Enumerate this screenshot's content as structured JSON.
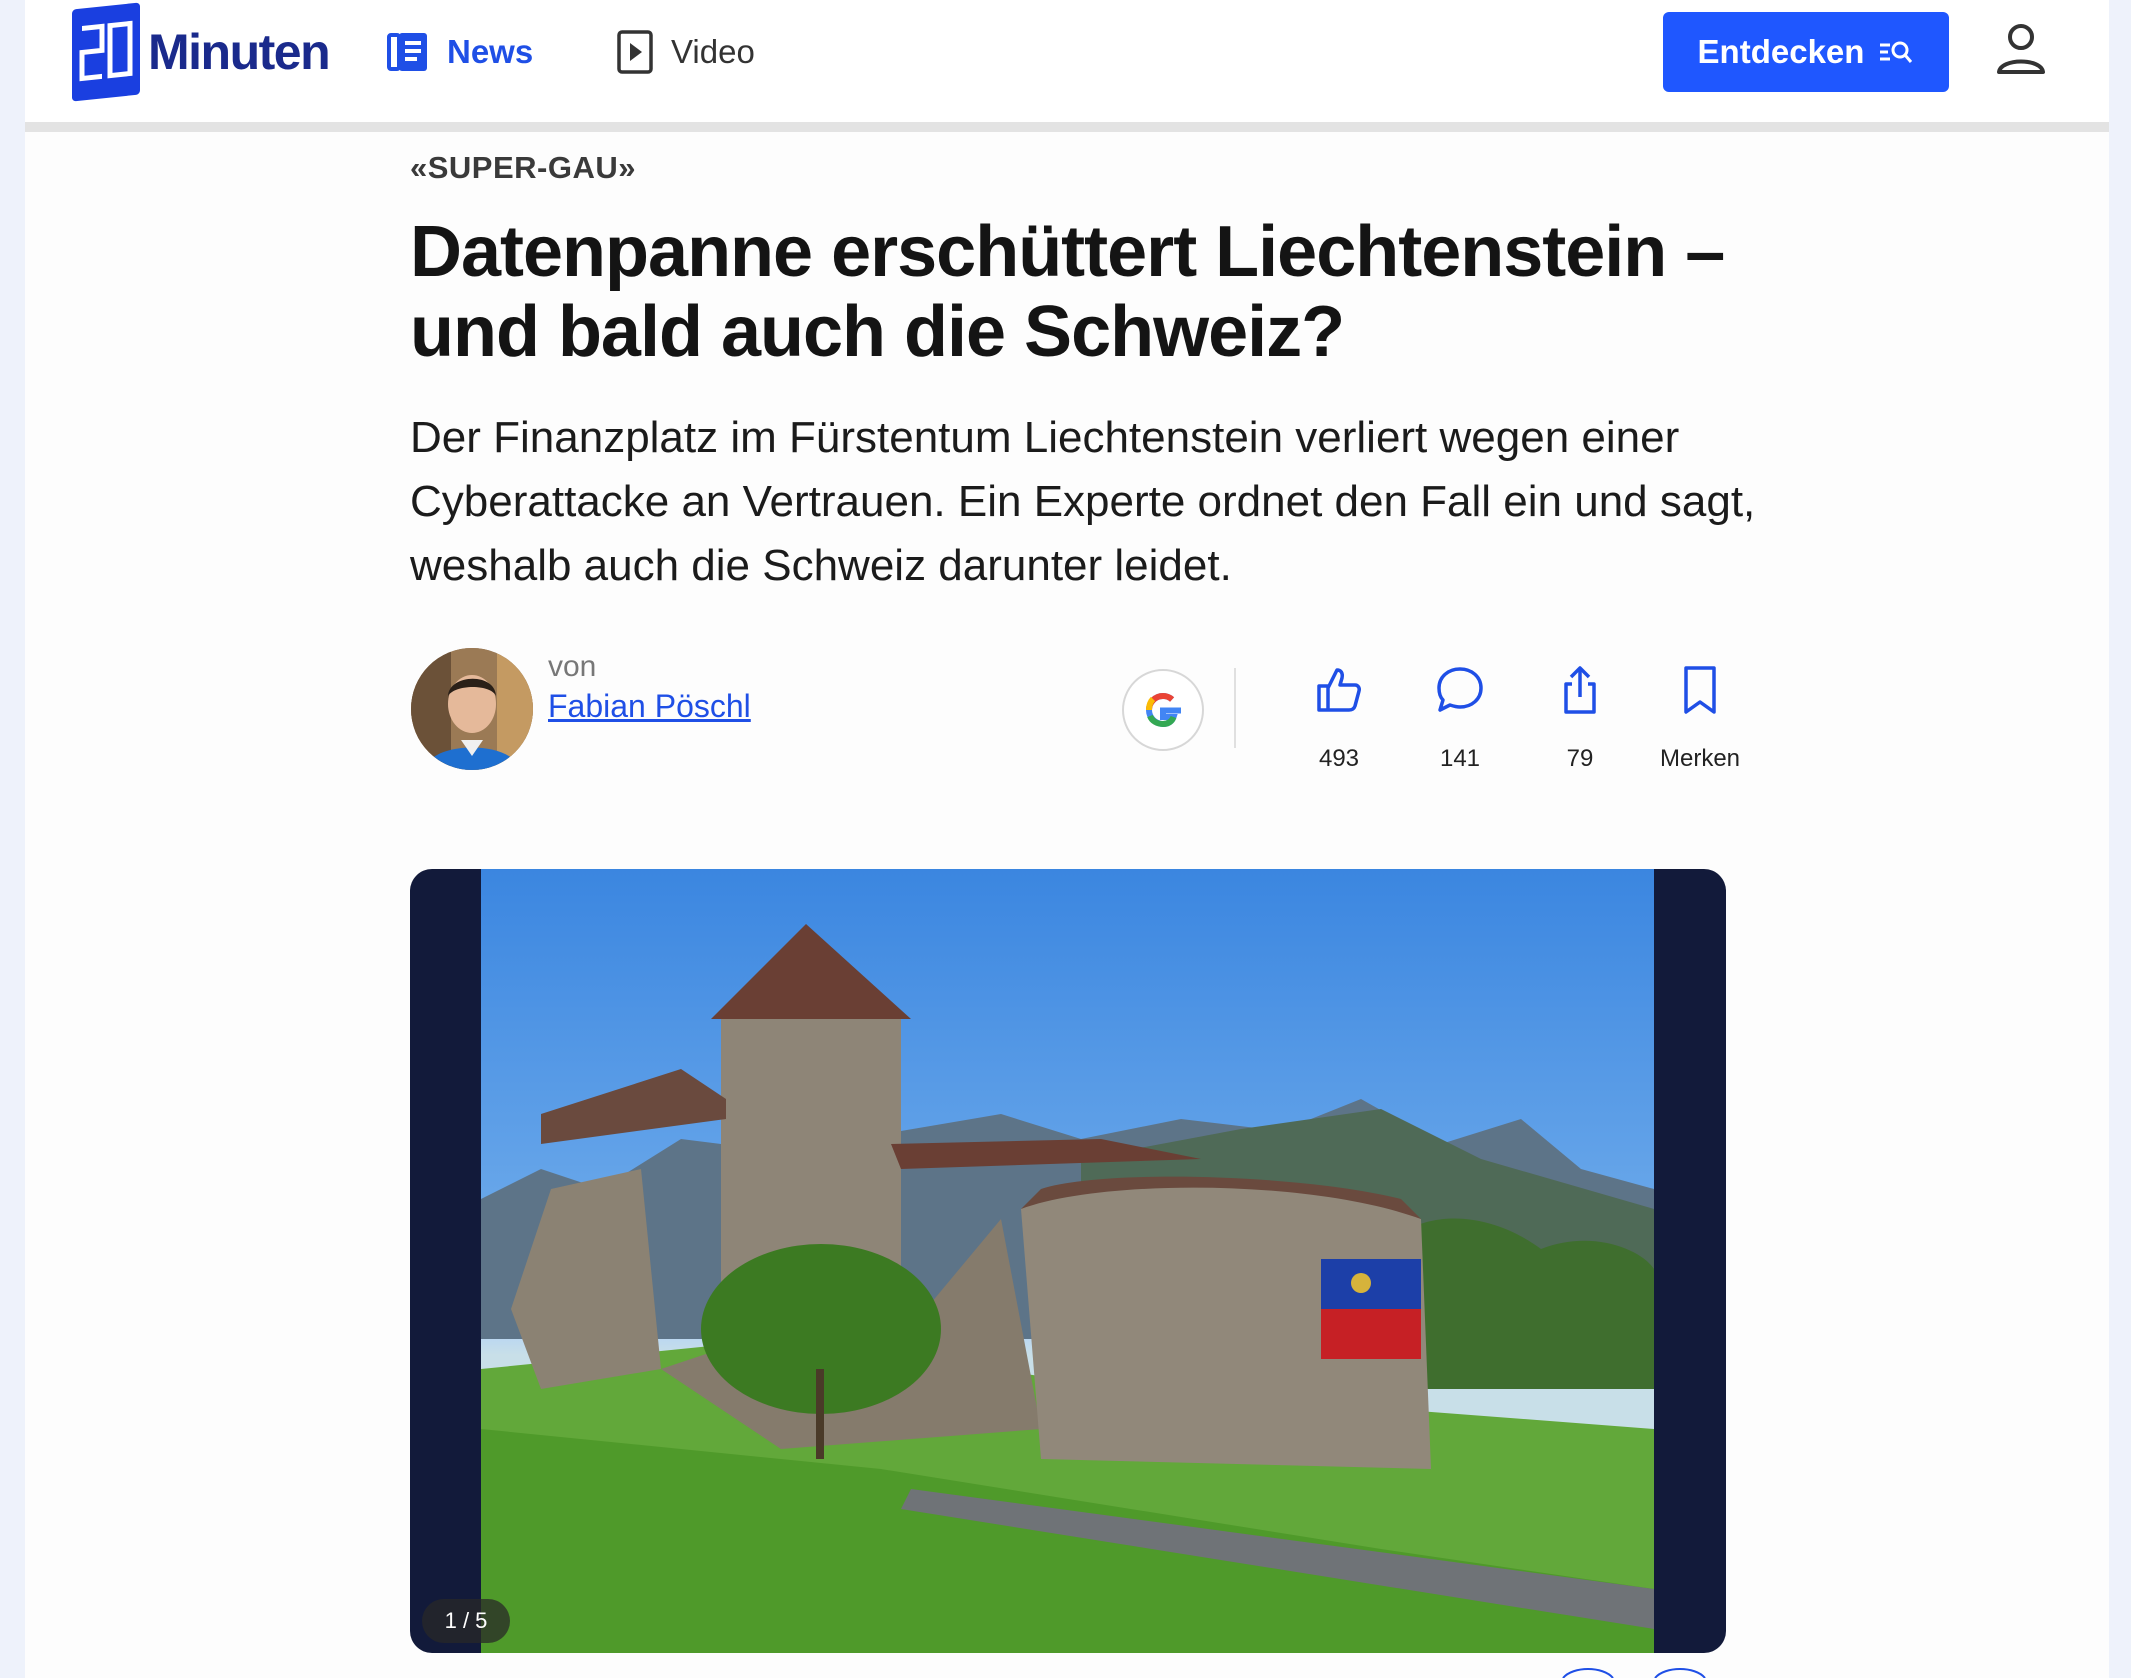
{
  "header": {
    "logo_text": "Minuten",
    "nav": {
      "news": "News",
      "video": "Video"
    },
    "explore_button": "Entdecken"
  },
  "article": {
    "kicker": "«SUPER-GAU»",
    "headline": "Datenpanne erschüttert Liechtenstein – und bald auch die Schweiz?",
    "lead": "Der Finanzplatz im Fürstentum Liechtenstein verliert wegen einer Cyberattacke an Vertrauen. Ein Experte ordnet den Fall ein und sagt, weshalb auch die Schweiz darunter leidet.",
    "byline_prefix": "von",
    "author": "Fabian Pöschl"
  },
  "actions": {
    "likes": "493",
    "comments": "141",
    "shares": "79",
    "bookmark": "Merken"
  },
  "gallery": {
    "counter": "1 / 5"
  },
  "colors": {
    "brand": "#1f57ff",
    "logo": "#1a3fe0",
    "gallery_bg": "#121a3a"
  }
}
